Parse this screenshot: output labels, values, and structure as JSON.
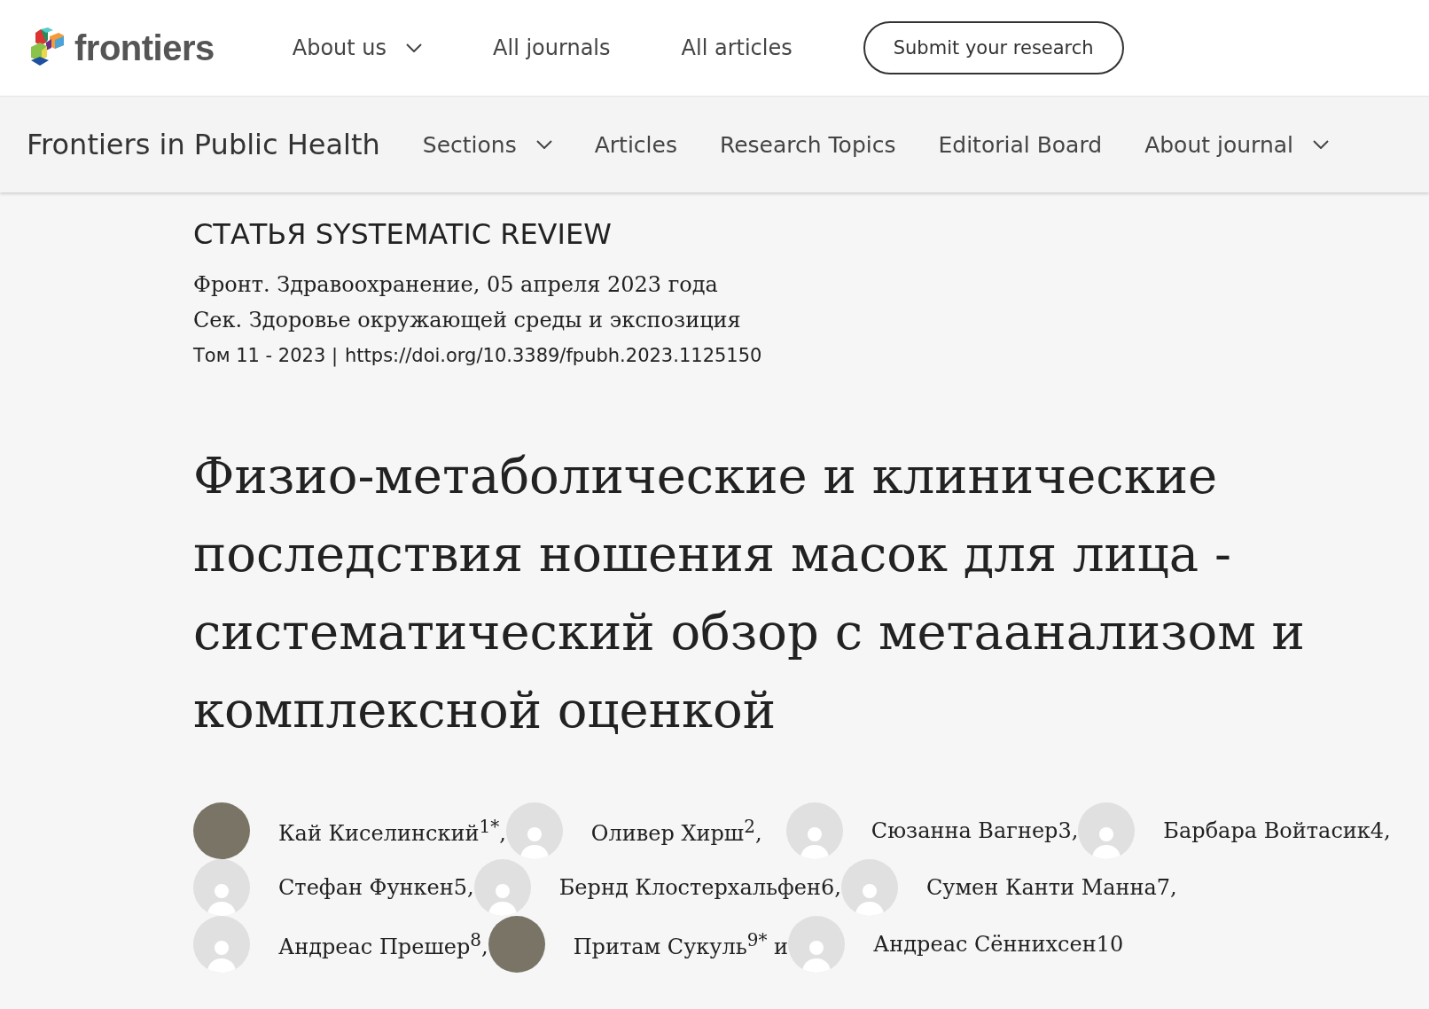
{
  "header": {
    "logo_text": "frontiers",
    "nav": [
      {
        "label": "About us",
        "has_menu": true
      },
      {
        "label": "All journals",
        "has_menu": false
      },
      {
        "label": "All articles",
        "has_menu": false
      }
    ],
    "submit_button": "Submit your research"
  },
  "journal_bar": {
    "title": "Frontiers in Public Health",
    "nav": [
      {
        "label": "Sections",
        "has_menu": true
      },
      {
        "label": "Articles",
        "has_menu": false
      },
      {
        "label": "Research Topics",
        "has_menu": false
      },
      {
        "label": "Editorial Board",
        "has_menu": false
      },
      {
        "label": "About journal",
        "has_menu": true
      }
    ]
  },
  "article": {
    "type": "СТАТЬЯ SYSTEMATIC REVIEW",
    "citation": "Фронт. Здравоохранение, 05 апреля 2023 года",
    "section": "Сек. Здоровье окружающей среды и экспозиция",
    "volume": "Том 11 - 2023 |",
    "doi": "https://doi.org/10.3389/fpubh.2023.1125150",
    "title": "Физио-метаболические и клинические последствия ношения масок для лица - систематический обзор с метаанализом и комплексной оценкой",
    "author_rows": [
      [
        {
          "kind": "photo",
          "name": "Кай Киселинский$^{1*}$,"
        },
        {
          "kind": "placeholder",
          "name": "Оливер Хирш$^{2}$,"
        },
        {
          "kind": "placeholder",
          "name": "Сюзанна Вагнер3,"
        },
        {
          "kind": "placeholder",
          "name": "Барбара Войтасик4,"
        }
      ],
      [
        {
          "kind": "placeholder",
          "name": "Стефан Функен5,"
        },
        {
          "kind": "placeholder",
          "name": "Бернд Клостерхальфен6,"
        },
        {
          "kind": "placeholder",
          "name": "Сумен Канти Манна7,"
        }
      ],
      [
        {
          "kind": "placeholder",
          "name": "Андреас Прешер$^{8}$,"
        },
        {
          "kind": "photo",
          "name": "Притам Сукуль$^{9*}$ и"
        },
        {
          "kind": "placeholder",
          "name": "Андреас Сённихсен10"
        }
      ]
    ]
  }
}
